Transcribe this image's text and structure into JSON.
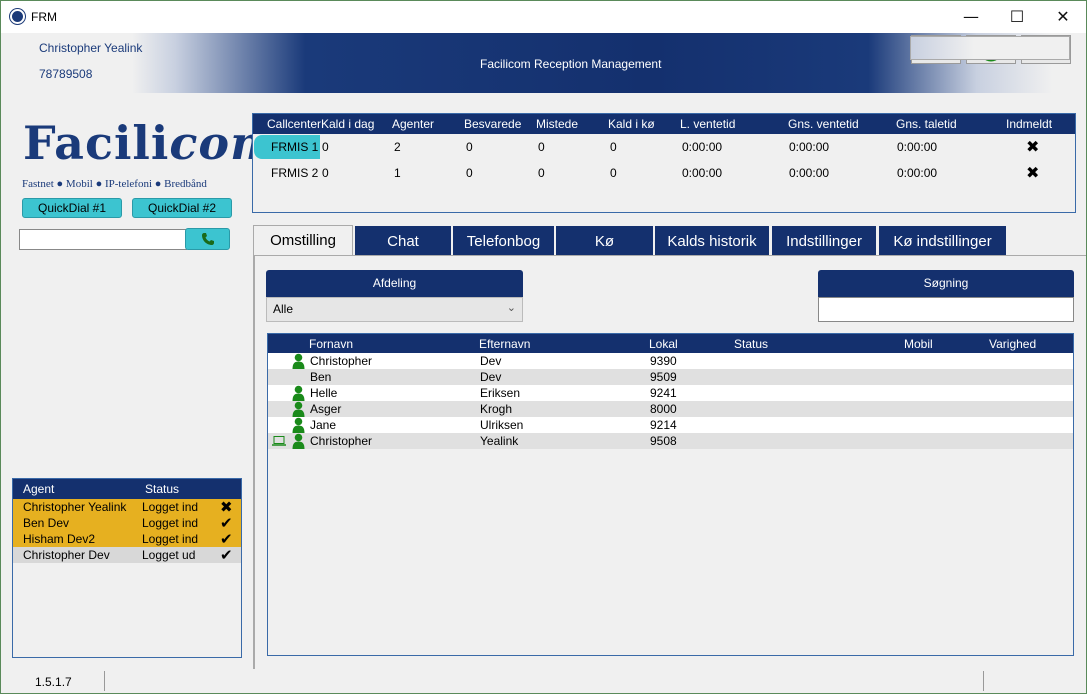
{
  "window": {
    "title": "FRM",
    "minimize": "—",
    "maximize": "☐",
    "close": "✕"
  },
  "header": {
    "user_name": "Christopher Yealink",
    "user_ext": "78789508",
    "title": "Facilicom Reception Management",
    "buttons": [
      "code-icon",
      "stop-icon",
      "fast-forward-icon"
    ]
  },
  "logo": {
    "main": "Facili",
    "italic": "com",
    "tagline": "Fastnet ● Mobil ● IP-telefoni ● Bredbånd"
  },
  "quickdial": [
    "QuickDial #1",
    "QuickDial #2"
  ],
  "dialer": {
    "value": "",
    "button_icon": "phone-icon"
  },
  "callcenter": {
    "columns": [
      "Callcenter",
      "Kald i dag",
      "Agenter",
      "Besvarede",
      "Mistede",
      "Kald i kø",
      "L. ventetid",
      "Gns. ventetid",
      "Gns. taletid",
      "Indmeldt"
    ],
    "rows": [
      {
        "name": "FRMIS 1",
        "calls": "0",
        "agents": "2",
        "answered": "0",
        "missed": "0",
        "queue": "0",
        "longest": "0:00:00",
        "avg_wait": "0:00:00",
        "avg_talk": "0:00:00",
        "status": "✖",
        "selected": true
      },
      {
        "name": "FRMIS 2",
        "calls": "0",
        "agents": "1",
        "answered": "0",
        "missed": "0",
        "queue": "0",
        "longest": "0:00:00",
        "avg_wait": "0:00:00",
        "avg_talk": "0:00:00",
        "status": "✖",
        "selected": false
      }
    ]
  },
  "agents": {
    "columns": [
      "Agent",
      "Status"
    ],
    "rows": [
      {
        "name": "Christopher Yealink",
        "status": "Logget ind",
        "mark": "✖",
        "color": "#e6b020"
      },
      {
        "name": "Ben Dev",
        "status": "Logget ind",
        "mark": "✔",
        "color": "#e6b020"
      },
      {
        "name": "Hisham Dev2",
        "status": "Logget ind",
        "mark": "✔",
        "color": "#e6b020"
      },
      {
        "name": "Christopher Dev",
        "status": "Logget ud",
        "mark": "✔",
        "color": "#d8d8d8"
      }
    ]
  },
  "tabs": [
    "Omstilling",
    "Chat",
    "Telefonbog",
    "Kø",
    "Kalds historik",
    "Indstillinger",
    "Kø indstillinger"
  ],
  "active_tab": "Omstilling",
  "department": {
    "label": "Afdeling",
    "value": "Alle",
    "chevron": "⌄"
  },
  "search": {
    "label": "Søgning",
    "value": ""
  },
  "directory": {
    "columns": [
      "Fornavn",
      "Efternavn",
      "Lokal",
      "Status",
      "Mobil",
      "Varighed"
    ],
    "rows": [
      {
        "first": "Christopher",
        "last": "Dev",
        "ext": "9390",
        "person": true,
        "laptop": false
      },
      {
        "first": "Ben",
        "last": "Dev",
        "ext": "9509",
        "person": false,
        "laptop": false
      },
      {
        "first": "Helle",
        "last": "Eriksen",
        "ext": "9241",
        "person": true,
        "laptop": false
      },
      {
        "first": "Asger",
        "last": "Krogh",
        "ext": "8000",
        "person": true,
        "laptop": false
      },
      {
        "first": "Jane",
        "last": "Ulriksen",
        "ext": "9214",
        "person": true,
        "laptop": false
      },
      {
        "first": "Christopher",
        "last": "Yealink",
        "ext": "9508",
        "person": true,
        "laptop": true
      }
    ]
  },
  "colors": {
    "navy": "#14306e",
    "teal": "#3cc4d0",
    "amber": "#e6b020",
    "green": "#1a8a1a"
  },
  "status_bar": {
    "version": "1.5.1.7"
  }
}
